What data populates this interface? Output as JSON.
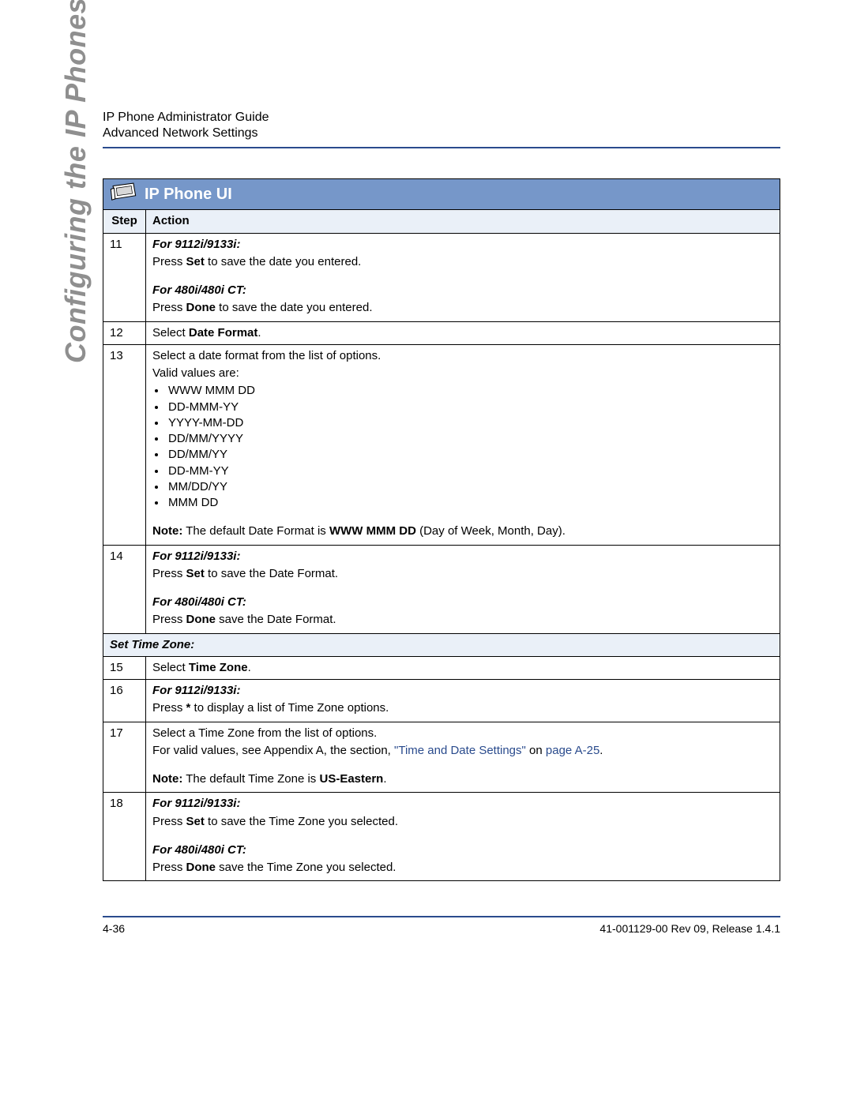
{
  "header": {
    "line1": "IP Phone Administrator Guide",
    "line2": "Advanced Network Settings"
  },
  "side_title": "Configuring the IP Phones",
  "banner": {
    "title": "IP Phone UI"
  },
  "columns": {
    "step": "Step",
    "action": "Action"
  },
  "rows": {
    "r11": {
      "step": "11",
      "model_a": "For 9112i/9133i:",
      "line_a1": "Press ",
      "line_a_bold": "Set",
      "line_a2": " to save the date you entered.",
      "model_b": "For 480i/480i CT:",
      "line_b1": "Press ",
      "line_b_bold": "Done",
      "line_b2": " to save the date you entered."
    },
    "r12": {
      "step": "12",
      "t1": "Select ",
      "t_bold": "Date Format",
      "t2": "."
    },
    "r13": {
      "step": "13",
      "intro1": "Select a date format from the list of options.",
      "intro2": "Valid values are:",
      "opts": [
        "WWW MMM DD",
        "DD-MMM-YY",
        "YYYY-MM-DD",
        "DD/MM/YYYY",
        "DD/MM/YY",
        "DD-MM-YY",
        "MM/DD/YY",
        "MMM DD"
      ],
      "note_label": "Note:",
      "note_1": " The default Date Format is ",
      "note_bold": "WWW MMM DD",
      "note_2": " (Day of Week, Month, Day)."
    },
    "r14": {
      "step": "14",
      "model_a": "For 9112i/9133i:",
      "line_a1": "Press ",
      "line_a_bold": "Set",
      "line_a2": " to save the Date Format.",
      "model_b": "For 480i/480i CT:",
      "line_b1": "Press ",
      "line_b_bold": "Done",
      "line_b2": " save the Date Format."
    },
    "section_tz": "Set Time Zone:",
    "r15": {
      "step": "15",
      "t1": "Select ",
      "t_bold": "Time Zone",
      "t2": "."
    },
    "r16": {
      "step": "16",
      "model_a": "For 9112i/9133i:",
      "line_a1": "Press ",
      "line_a_bold": "*",
      "line_a2": " to display a list of Time Zone options."
    },
    "r17": {
      "step": "17",
      "l1": "Select a Time Zone from the list of options.",
      "l2a": "For valid values, see Appendix A, the section, ",
      "l2_link1": "\"Time and Date Settings\"",
      "l2b": " on ",
      "l2_link2": "page A-25",
      "l2c": ".",
      "note_label": "Note:",
      "note_1": " The default Time Zone is ",
      "note_bold": "US-Eastern",
      "note_2": "."
    },
    "r18": {
      "step": "18",
      "model_a": "For 9112i/9133i:",
      "line_a1": "Press ",
      "line_a_bold": "Set",
      "line_a2": " to save the Time Zone you selected.",
      "model_b": "For 480i/480i CT:",
      "line_b1": "Press ",
      "line_b_bold": "Done",
      "line_b2": " save the Time Zone you selected."
    }
  },
  "footer": {
    "left": "4-36",
    "right": "41-001129-00 Rev 09, Release 1.4.1"
  }
}
